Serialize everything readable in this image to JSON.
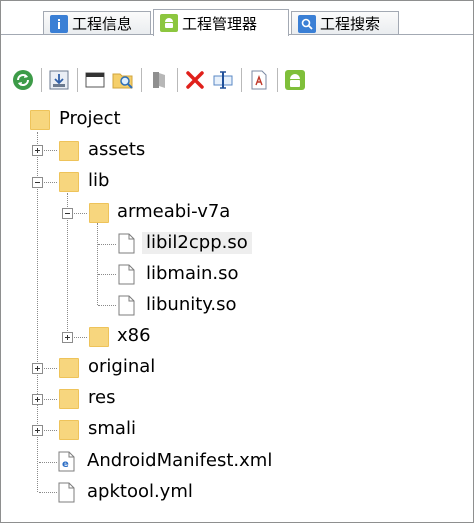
{
  "tabs": [
    {
      "label": "工程信息",
      "icon": "info-icon",
      "color": "#3a7fd5"
    },
    {
      "label": "工程管理器",
      "icon": "android-icon",
      "color": "#8cc63f",
      "active": true
    },
    {
      "label": "工程搜索",
      "icon": "search-icon",
      "color": "#3a7fd5"
    }
  ],
  "toolbar": {
    "buttons": [
      {
        "name": "refresh-icon"
      },
      {
        "name": "import-icon"
      },
      {
        "name": "window-icon"
      },
      {
        "name": "folder-search-icon"
      },
      {
        "name": "book-icon"
      },
      {
        "name": "delete-icon"
      },
      {
        "name": "rename-icon"
      },
      {
        "name": "text-file-icon"
      },
      {
        "name": "android-icon"
      }
    ]
  },
  "tree": {
    "root": "Project",
    "nodes": {
      "assets": "assets",
      "lib": "lib",
      "armeabi": "armeabi-v7a",
      "libil2cpp": "libil2cpp.so",
      "libmain": "libmain.so",
      "libunity": "libunity.so",
      "x86": "x86",
      "original": "original",
      "res": "res",
      "smali": "smali",
      "manifest": "AndroidManifest.xml",
      "apktool": "apktool.yml"
    },
    "selected": "libil2cpp.so"
  }
}
